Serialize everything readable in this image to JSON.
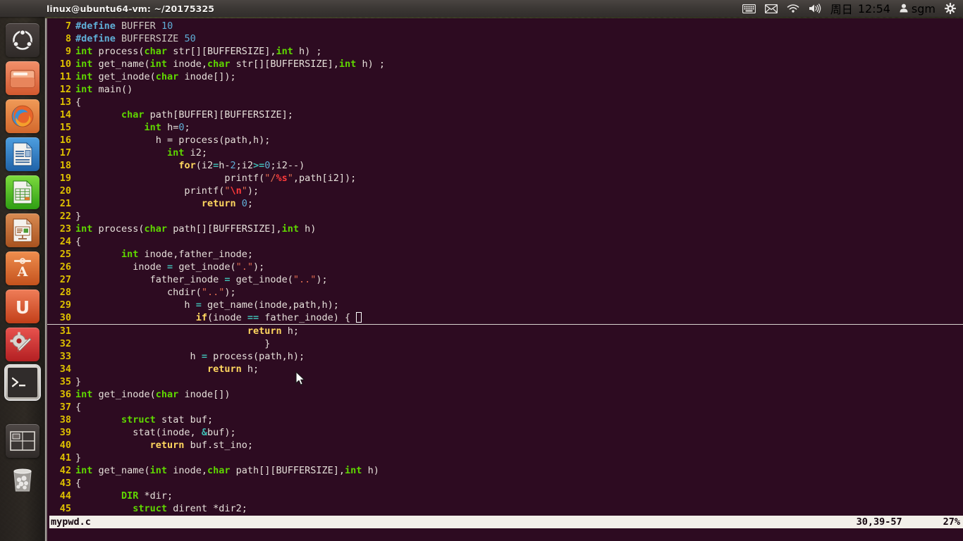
{
  "panel": {
    "title": "linux@ubuntu64-vm: ~/20175325",
    "tray": {
      "keyboard_icon": "keyboard-icon",
      "mail_icon": "mail-icon",
      "network_icon": "wifi-icon",
      "volume_icon": "volume-icon",
      "day": "周日",
      "time": "12:54",
      "user_icon": "user-icon",
      "user": "sgm",
      "settings_icon": "gear-icon"
    }
  },
  "launcher": {
    "items": [
      {
        "name": "ubuntu-dash",
        "label": "Ubuntu Dash",
        "active": false
      },
      {
        "name": "files",
        "label": "Files",
        "active": false
      },
      {
        "name": "firefox",
        "label": "Firefox Web Browser",
        "active": false
      },
      {
        "name": "libreoffice-writer",
        "label": "LibreOffice Writer",
        "active": false
      },
      {
        "name": "libreoffice-calc",
        "label": "LibreOffice Calc",
        "active": false
      },
      {
        "name": "libreoffice-impress",
        "label": "LibreOffice Impress",
        "active": false
      },
      {
        "name": "ubuntu-software",
        "label": "Ubuntu Software",
        "active": false
      },
      {
        "name": "amazon",
        "label": "Amazon",
        "active": false
      },
      {
        "name": "system-settings",
        "label": "System Settings",
        "active": false
      },
      {
        "name": "terminal",
        "label": "Terminal",
        "active": true
      },
      {
        "name": "workspace-switcher",
        "label": "Workspace Switcher",
        "active": false
      },
      {
        "name": "trash",
        "label": "Trash",
        "active": false
      }
    ]
  },
  "editor": {
    "first_line": 7,
    "cursor_line": 30,
    "lines": [
      {
        "n": 7,
        "tokens": [
          {
            "t": "#define ",
            "c": "pp"
          },
          {
            "t": "BUFFER ",
            "c": "id"
          },
          {
            "t": "10",
            "c": "num"
          }
        ]
      },
      {
        "n": 8,
        "tokens": [
          {
            "t": "#define ",
            "c": "pp"
          },
          {
            "t": "BUFFERSIZE ",
            "c": "id"
          },
          {
            "t": "50",
            "c": "num"
          }
        ]
      },
      {
        "n": 9,
        "tokens": [
          {
            "t": "int",
            "c": "k"
          },
          {
            "t": " process(",
            "c": "txt"
          },
          {
            "t": "char",
            "c": "k"
          },
          {
            "t": " str[][BUFFERSIZE],",
            "c": "txt"
          },
          {
            "t": "int",
            "c": "k"
          },
          {
            "t": " h) ;",
            "c": "txt"
          }
        ]
      },
      {
        "n": 10,
        "tokens": [
          {
            "t": "int",
            "c": "k"
          },
          {
            "t": " get_name(",
            "c": "txt"
          },
          {
            "t": "int",
            "c": "k"
          },
          {
            "t": " inode,",
            "c": "txt"
          },
          {
            "t": "char",
            "c": "k"
          },
          {
            "t": " str[][BUFFERSIZE],",
            "c": "txt"
          },
          {
            "t": "int",
            "c": "k"
          },
          {
            "t": " h) ;",
            "c": "txt"
          }
        ]
      },
      {
        "n": 11,
        "tokens": [
          {
            "t": "int",
            "c": "k"
          },
          {
            "t": " get_inode(",
            "c": "txt"
          },
          {
            "t": "char",
            "c": "k"
          },
          {
            "t": " inode[]);",
            "c": "txt"
          }
        ]
      },
      {
        "n": 12,
        "tokens": [
          {
            "t": "int",
            "c": "k"
          },
          {
            "t": " main()",
            "c": "txt"
          }
        ]
      },
      {
        "n": 13,
        "tokens": [
          {
            "t": "{",
            "c": "txt"
          }
        ]
      },
      {
        "n": 14,
        "tokens": [
          {
            "t": "        ",
            "c": "txt"
          },
          {
            "t": "char",
            "c": "k"
          },
          {
            "t": " path[BUFFER][BUFFERSIZE];",
            "c": "txt"
          }
        ]
      },
      {
        "n": 15,
        "tokens": [
          {
            "t": "            ",
            "c": "txt"
          },
          {
            "t": "int",
            "c": "k"
          },
          {
            "t": " h=",
            "c": "txt"
          },
          {
            "t": "0",
            "c": "num"
          },
          {
            "t": ";",
            "c": "txt"
          }
        ]
      },
      {
        "n": 16,
        "tokens": [
          {
            "t": "              h = process(path,h);",
            "c": "txt"
          }
        ]
      },
      {
        "n": 17,
        "tokens": [
          {
            "t": "                ",
            "c": "txt"
          },
          {
            "t": "int",
            "c": "k"
          },
          {
            "t": " i2;",
            "c": "txt"
          }
        ]
      },
      {
        "n": 18,
        "tokens": [
          {
            "t": "                  ",
            "c": "txt"
          },
          {
            "t": "for",
            "c": "kw"
          },
          {
            "t": "(i2",
            "c": "txt"
          },
          {
            "t": "=",
            "c": "op"
          },
          {
            "t": "h-",
            "c": "txt"
          },
          {
            "t": "2",
            "c": "num"
          },
          {
            "t": ";i2",
            "c": "txt"
          },
          {
            "t": ">=",
            "c": "op"
          },
          {
            "t": "0",
            "c": "num"
          },
          {
            "t": ";i2--)",
            "c": "txt"
          }
        ]
      },
      {
        "n": 19,
        "tokens": [
          {
            "t": "                          printf(",
            "c": "txt"
          },
          {
            "t": "\"/",
            "c": "str"
          },
          {
            "t": "%s",
            "c": "esc"
          },
          {
            "t": "\"",
            "c": "str"
          },
          {
            "t": ",path[i2]);",
            "c": "txt"
          }
        ]
      },
      {
        "n": 20,
        "tokens": [
          {
            "t": "                   printf(",
            "c": "txt"
          },
          {
            "t": "\"",
            "c": "str"
          },
          {
            "t": "\\n",
            "c": "esc"
          },
          {
            "t": "\"",
            "c": "str"
          },
          {
            "t": ");",
            "c": "txt"
          }
        ]
      },
      {
        "n": 21,
        "tokens": [
          {
            "t": "                      ",
            "c": "txt"
          },
          {
            "t": "return",
            "c": "kw"
          },
          {
            "t": " ",
            "c": "txt"
          },
          {
            "t": "0",
            "c": "num"
          },
          {
            "t": ";",
            "c": "txt"
          }
        ]
      },
      {
        "n": 22,
        "tokens": [
          {
            "t": "}",
            "c": "txt"
          }
        ]
      },
      {
        "n": 23,
        "tokens": [
          {
            "t": "int",
            "c": "k"
          },
          {
            "t": " process(",
            "c": "txt"
          },
          {
            "t": "char",
            "c": "k"
          },
          {
            "t": " path[][BUFFERSIZE],",
            "c": "txt"
          },
          {
            "t": "int",
            "c": "k"
          },
          {
            "t": " h)",
            "c": "txt"
          }
        ]
      },
      {
        "n": 24,
        "tokens": [
          {
            "t": "{",
            "c": "txt"
          }
        ]
      },
      {
        "n": 25,
        "tokens": [
          {
            "t": "        ",
            "c": "txt"
          },
          {
            "t": "int",
            "c": "k"
          },
          {
            "t": " inode,father_inode;",
            "c": "txt"
          }
        ]
      },
      {
        "n": 26,
        "tokens": [
          {
            "t": "          inode ",
            "c": "txt"
          },
          {
            "t": "=",
            "c": "op"
          },
          {
            "t": " get_inode(",
            "c": "txt"
          },
          {
            "t": "\".\"",
            "c": "str"
          },
          {
            "t": ");",
            "c": "txt"
          }
        ]
      },
      {
        "n": 27,
        "tokens": [
          {
            "t": "             father_inode ",
            "c": "txt"
          },
          {
            "t": "=",
            "c": "op"
          },
          {
            "t": " get_inode(",
            "c": "txt"
          },
          {
            "t": "\"..\"",
            "c": "str"
          },
          {
            "t": ");",
            "c": "txt"
          }
        ]
      },
      {
        "n": 28,
        "tokens": [
          {
            "t": "                chdir(",
            "c": "txt"
          },
          {
            "t": "\"..\"",
            "c": "str"
          },
          {
            "t": ");",
            "c": "txt"
          }
        ]
      },
      {
        "n": 29,
        "tokens": [
          {
            "t": "                   h ",
            "c": "txt"
          },
          {
            "t": "=",
            "c": "op"
          },
          {
            "t": " get_name(inode,path,h);",
            "c": "txt"
          }
        ]
      },
      {
        "n": 30,
        "cursor": true,
        "tokens": [
          {
            "t": "                     ",
            "c": "txt"
          },
          {
            "t": "if",
            "c": "kw"
          },
          {
            "t": "(inode ",
            "c": "txt"
          },
          {
            "t": "==",
            "c": "op"
          },
          {
            "t": " father_inode) { ",
            "c": "txt"
          }
        ]
      },
      {
        "n": 31,
        "tokens": [
          {
            "t": "                              ",
            "c": "txt"
          },
          {
            "t": "return",
            "c": "kw"
          },
          {
            "t": " h;",
            "c": "txt"
          }
        ]
      },
      {
        "n": 32,
        "tokens": [
          {
            "t": "                                 }",
            "c": "txt"
          }
        ]
      },
      {
        "n": 33,
        "tokens": [
          {
            "t": "                    h ",
            "c": "txt"
          },
          {
            "t": "=",
            "c": "op"
          },
          {
            "t": " process(path,h);",
            "c": "txt"
          }
        ]
      },
      {
        "n": 34,
        "tokens": [
          {
            "t": "                       ",
            "c": "txt"
          },
          {
            "t": "return",
            "c": "kw"
          },
          {
            "t": " h;",
            "c": "txt"
          }
        ]
      },
      {
        "n": 35,
        "tokens": [
          {
            "t": "}",
            "c": "txt"
          }
        ]
      },
      {
        "n": 36,
        "tokens": [
          {
            "t": "int",
            "c": "k"
          },
          {
            "t": " get_inode(",
            "c": "txt"
          },
          {
            "t": "char",
            "c": "k"
          },
          {
            "t": " inode[])",
            "c": "txt"
          }
        ]
      },
      {
        "n": 37,
        "tokens": [
          {
            "t": "{",
            "c": "txt"
          }
        ]
      },
      {
        "n": 38,
        "tokens": [
          {
            "t": "        ",
            "c": "txt"
          },
          {
            "t": "struct",
            "c": "k"
          },
          {
            "t": " stat buf;",
            "c": "txt"
          }
        ]
      },
      {
        "n": 39,
        "tokens": [
          {
            "t": "          stat(inode, ",
            "c": "txt"
          },
          {
            "t": "&",
            "c": "op"
          },
          {
            "t": "buf);",
            "c": "txt"
          }
        ]
      },
      {
        "n": 40,
        "tokens": [
          {
            "t": "             ",
            "c": "txt"
          },
          {
            "t": "return",
            "c": "kw"
          },
          {
            "t": " buf.st_ino;",
            "c": "txt"
          }
        ]
      },
      {
        "n": 41,
        "tokens": [
          {
            "t": "}",
            "c": "txt"
          }
        ]
      },
      {
        "n": 42,
        "tokens": [
          {
            "t": "int",
            "c": "k"
          },
          {
            "t": " get_name(",
            "c": "txt"
          },
          {
            "t": "int",
            "c": "k"
          },
          {
            "t": " inode,",
            "c": "txt"
          },
          {
            "t": "char",
            "c": "k"
          },
          {
            "t": " path[][BUFFERSIZE],",
            "c": "txt"
          },
          {
            "t": "int",
            "c": "k"
          },
          {
            "t": " h)",
            "c": "txt"
          }
        ]
      },
      {
        "n": 43,
        "tokens": [
          {
            "t": "{",
            "c": "txt"
          }
        ]
      },
      {
        "n": 44,
        "tokens": [
          {
            "t": "        ",
            "c": "txt"
          },
          {
            "t": "DIR",
            "c": "k"
          },
          {
            "t": " *dir;",
            "c": "txt"
          }
        ]
      },
      {
        "n": 45,
        "tokens": [
          {
            "t": "          ",
            "c": "txt"
          },
          {
            "t": "struct",
            "c": "k"
          },
          {
            "t": " dirent *dir2;",
            "c": "txt"
          }
        ]
      }
    ]
  },
  "statusbar": {
    "filename": "mypwd.c",
    "position": "30,39-57",
    "percent": "27%"
  },
  "colors": {
    "terminal_bg": "#2d0b21",
    "panel_bg": "#3b3734",
    "status_bg": "#f2efe9",
    "linenum": "#ddc000",
    "keyword_type": "#5fd700",
    "keyword_ctrl": "#ffd75f",
    "preproc": "#5fafd7",
    "string": "#e06c50",
    "escape": "#ff3a3a",
    "operator": "#3fb8b0"
  }
}
